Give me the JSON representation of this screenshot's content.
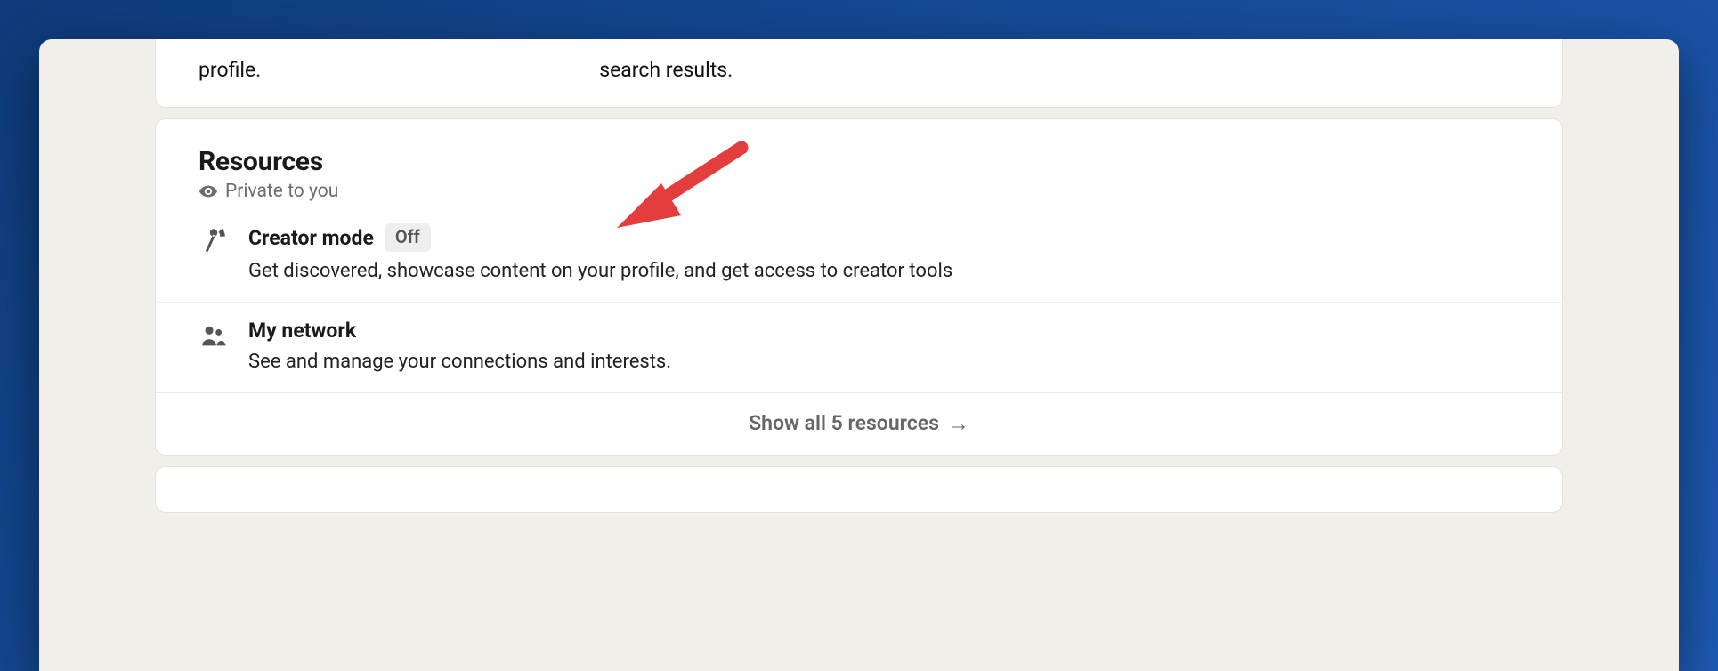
{
  "prev_card": {
    "left_fragment": "profile.",
    "right_fragment": "search results."
  },
  "resources": {
    "title": "Resources",
    "privacy_label": "Private to you",
    "items": [
      {
        "icon": "antenna-icon",
        "title": "Creator mode",
        "badge": "Off",
        "description": "Get discovered, showcase content on your profile, and get access to creator tools"
      },
      {
        "icon": "people-icon",
        "title": "My network",
        "badge": null,
        "description": "See and manage your connections and interests."
      }
    ],
    "show_all_label": "Show all 5 resources"
  }
}
